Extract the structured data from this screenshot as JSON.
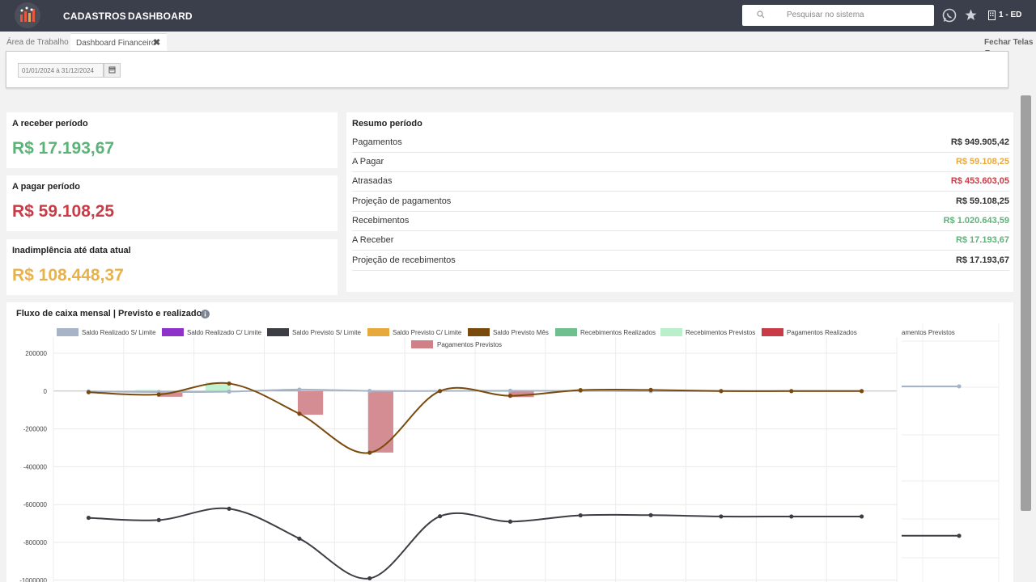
{
  "topbar": {
    "nav": [
      "CADASTROS",
      "DASHBOARD"
    ],
    "search_placeholder": "Pesquisar no sistema",
    "company": "1 - ED",
    "icons": [
      "search-icon",
      "whatsapp-icon",
      "star-icon",
      "building-icon"
    ]
  },
  "tabs": {
    "workspace": "Área de Trabalho",
    "active": "Dashboard Financeiro",
    "close": "✖",
    "close_all": "Fechar Telas"
  },
  "filter": {
    "date_range": "01/01/2024 à 31/12/2024"
  },
  "cards": {
    "receber": {
      "title": "A receber período",
      "value": "R$ 17.193,67",
      "color": "#5cb377"
    },
    "pagar": {
      "title": "A pagar período",
      "value": "R$ 59.108,25",
      "color": "#c73c46"
    },
    "inadimplencia": {
      "title": "Inadimplência até data atual",
      "value": "R$ 108.448,37",
      "color": "#e8b24a"
    }
  },
  "resumo": {
    "title": "Resumo período",
    "rows": [
      {
        "label": "Pagamentos",
        "value": "R$ 949.905,42",
        "color": "#333333"
      },
      {
        "label": "A Pagar",
        "value": "R$ 59.108,25",
        "color": "#e8a93c"
      },
      {
        "label": "Atrasadas",
        "value": "R$ 453.603,05",
        "color": "#c73c46"
      },
      {
        "label": "Projeção de pagamentos",
        "value": "R$ 59.108,25",
        "color": "#333333"
      },
      {
        "label": "Recebimentos",
        "value": "R$ 1.020.643,59",
        "color": "#5cb377"
      },
      {
        "label": "A Receber",
        "value": "R$ 17.193,67",
        "color": "#5cb377"
      },
      {
        "label": "Projeção de recebimentos",
        "value": "R$ 17.193,67",
        "color": "#333333"
      }
    ]
  },
  "chart": {
    "title": "Fluxo de caixa mensal | Previsto e realizado",
    "overlay_legend_fragment": "amentos Previstos"
  },
  "chart_data": {
    "type": "bar",
    "title": "Fluxo de caixa mensal | Previsto e realizado",
    "y_ticks": [
      "200000",
      "0",
      "-200000",
      "-400000",
      "-600000",
      "-800000",
      "-1000000"
    ],
    "ylim": [
      -1000000,
      200000
    ],
    "x_count": 12,
    "legend_placement": "top",
    "grid": true,
    "series": [
      {
        "name": "Saldo Realizado S/ Limite",
        "kind": "line",
        "color": "#a7b4c8",
        "values": [
          -2000,
          -5000,
          -3000,
          8000,
          1000,
          500,
          2000,
          1000,
          0,
          0,
          0,
          0
        ]
      },
      {
        "name": "Saldo Realizado C/ Limite",
        "kind": "line",
        "color": "#8e32c9",
        "values": []
      },
      {
        "name": "Saldo Previsto S/ Limite",
        "kind": "line",
        "color": "#3d3d44",
        "values": [
          -670000,
          -682000,
          -622000,
          -780000,
          -990000,
          -662000,
          -690000,
          -657000,
          -656000,
          -663000,
          -663000,
          -663000
        ]
      },
      {
        "name": "Saldo Previsto C/ Limite",
        "kind": "line",
        "color": "#e8a93c",
        "values": []
      },
      {
        "name": "Saldo Previsto Mês",
        "kind": "line",
        "color": "#7a4a0c",
        "values": [
          -6000,
          -18000,
          40000,
          -120000,
          -326000,
          0,
          -25000,
          5000,
          6000,
          0,
          0,
          0
        ]
      },
      {
        "name": "Recebimentos Realizados",
        "kind": "bar",
        "color": "#6fbf8f",
        "values": [
          0,
          3000,
          5000,
          3000,
          0,
          2000,
          1000,
          0,
          0,
          0,
          0,
          0
        ]
      },
      {
        "name": "Recebimentos Previstos",
        "kind": "bar",
        "color": "#b9f0cb",
        "values": [
          0,
          6000,
          45000,
          0,
          0,
          0,
          4000,
          0,
          0,
          0,
          0,
          0
        ]
      },
      {
        "name": "Pagamentos Realizados",
        "kind": "bar",
        "color": "#c73c46",
        "values": [
          0,
          0,
          0,
          0,
          0,
          0,
          0,
          0,
          0,
          0,
          0,
          0
        ]
      },
      {
        "name": "Pagamentos Previstos",
        "kind": "bar",
        "color": "#cf8187",
        "values": [
          0,
          -30000,
          0,
          -125000,
          -325000,
          0,
          -32000,
          0,
          0,
          0,
          0,
          0
        ]
      }
    ],
    "overlay_series": [
      {
        "name": "Saldo Realizado S/ Limite",
        "color": "#a7b4c8",
        "values": [
          25000,
          25000
        ]
      },
      {
        "name": "Saldo Previsto S/ Limite",
        "color": "#3d3d44",
        "values": [
          -765000,
          -765000
        ]
      }
    ]
  }
}
